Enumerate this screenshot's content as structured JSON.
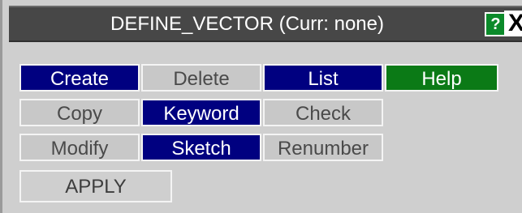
{
  "window": {
    "title": "DEFINE_VECTOR (Curr: none)",
    "help_label": "?",
    "close_label": "X"
  },
  "buttons": {
    "create": "Create",
    "delete": "Delete",
    "list": "List",
    "help": "Help",
    "copy": "Copy",
    "keyword": "Keyword",
    "check": "Check",
    "modify": "Modify",
    "sketch": "Sketch",
    "renumber": "Renumber",
    "apply": "APPLY"
  },
  "colors": {
    "active_blue": "#000080",
    "inactive_grey": "#c8c8c8",
    "help_green": "#0b7a16",
    "titlebar": "#474747"
  }
}
